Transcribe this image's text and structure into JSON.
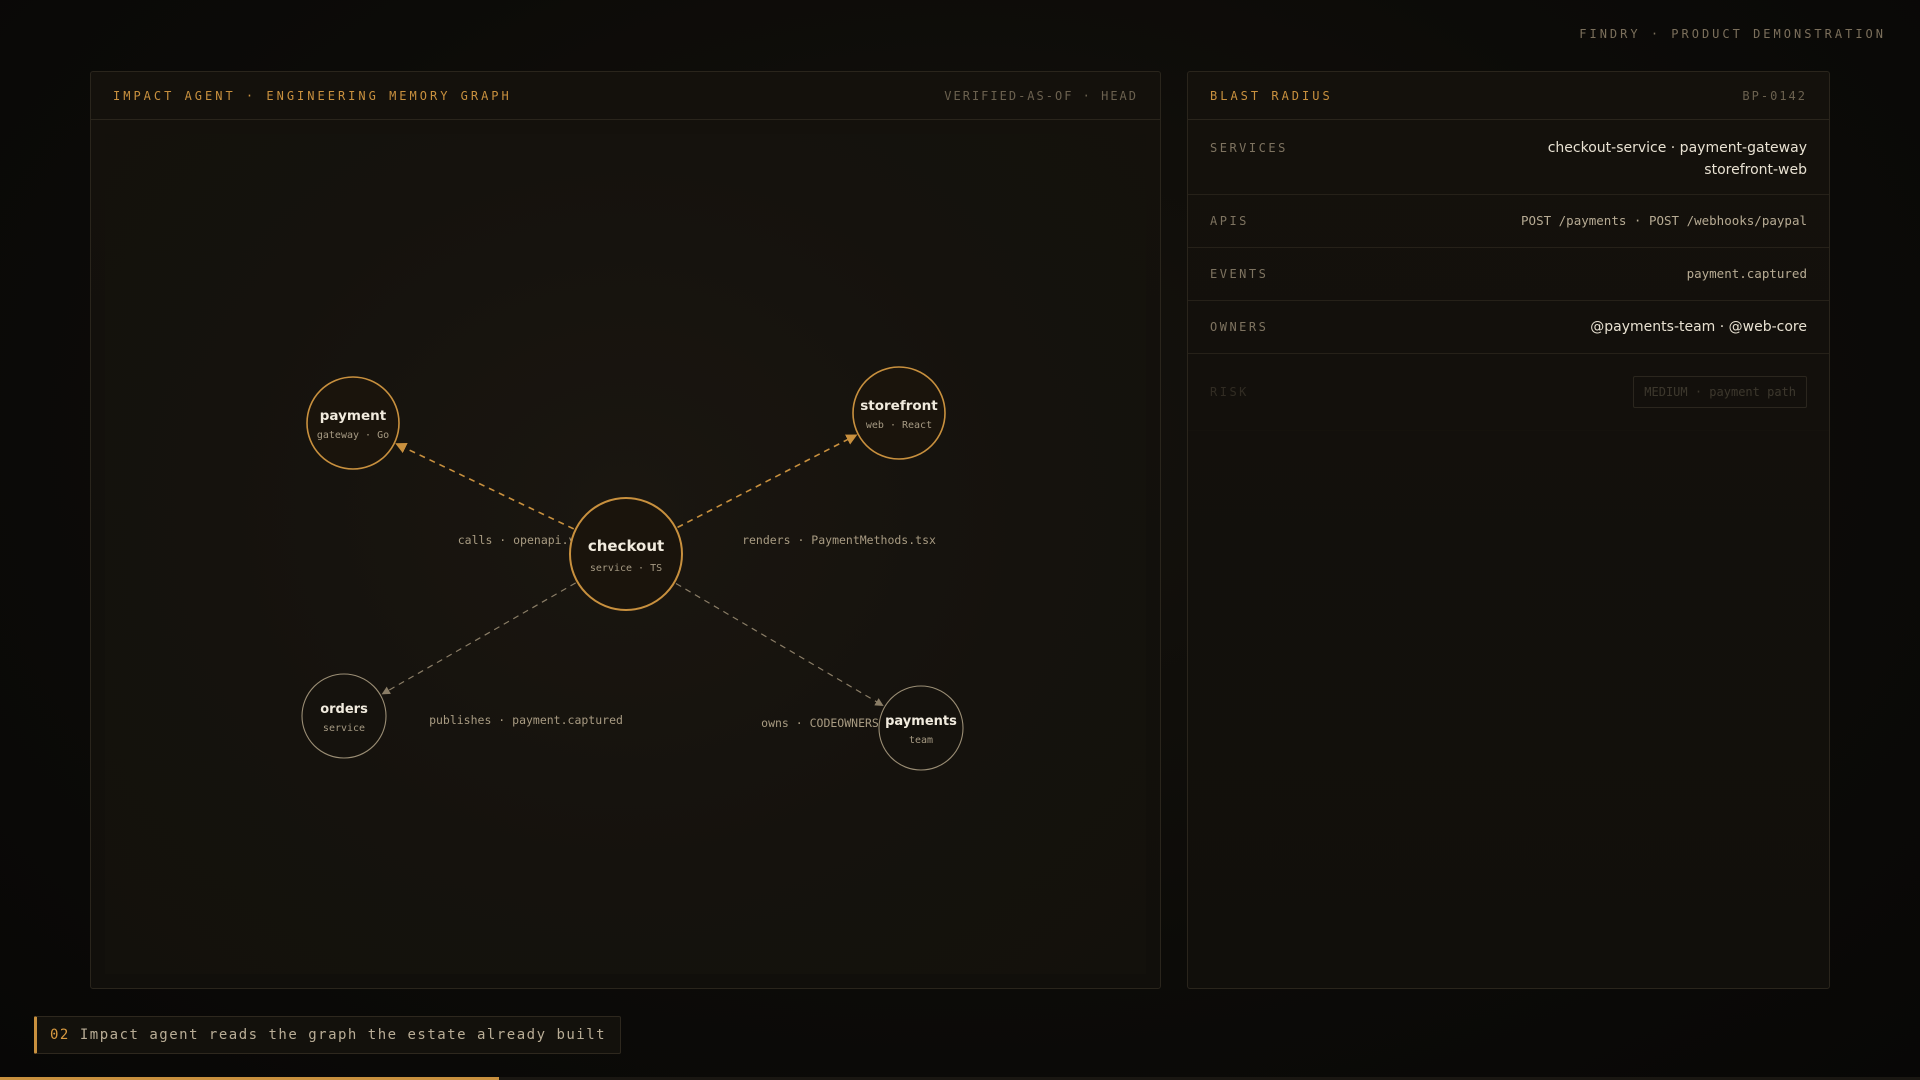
{
  "brand": "FINDRY · PRODUCT DEMONSTRATION",
  "graph_panel": {
    "title": "IMPACT AGENT · ENGINEERING MEMORY GRAPH",
    "status": "VERIFIED-AS-OF · HEAD"
  },
  "graph": {
    "nodes": [
      {
        "id": "checkout",
        "title": "checkout",
        "subtitle": "service · TS",
        "primary": true
      },
      {
        "id": "payment",
        "title": "payment",
        "subtitle": "gateway · Go",
        "primary": true
      },
      {
        "id": "storefront",
        "title": "storefront",
        "subtitle": "web · React",
        "primary": true
      },
      {
        "id": "orders",
        "title": "orders",
        "subtitle": "service",
        "primary": false
      },
      {
        "id": "payments",
        "title": "payments",
        "subtitle": "team",
        "primary": false
      }
    ],
    "edges": [
      {
        "from": "checkout",
        "to": "payment",
        "label": "calls · openapi.yaml",
        "style": "primary"
      },
      {
        "from": "checkout",
        "to": "storefront",
        "label": "renders · PaymentMethods.tsx",
        "style": "primary"
      },
      {
        "from": "checkout",
        "to": "orders",
        "label": "publishes · payment.captured",
        "style": "secondary"
      },
      {
        "from": "checkout",
        "to": "payments",
        "label": "owns · CODEOWNERS",
        "style": "secondary"
      }
    ]
  },
  "blast_radius": {
    "title": "BLAST RADIUS",
    "id": "BP-0142",
    "services_label": "SERVICES",
    "services_line1": "checkout-service · payment-gateway",
    "services_line2": "storefront-web",
    "apis_label": "APIS",
    "apis_value": "POST /payments · POST /webhooks/paypal",
    "events_label": "EVENTS",
    "events_value": "payment.captured",
    "owners_label": "OWNERS",
    "owners_value": "@payments-team · @web-core",
    "risk_label": "RISK",
    "risk_value": "MEDIUM · payment path"
  },
  "caption": {
    "number": "02",
    "text": "Impact agent reads the graph the estate already built"
  },
  "progress": {
    "fraction": 0.26
  },
  "colors": {
    "accent": "#c8903e",
    "secondary_stroke": "#8a7d66",
    "background": "#0c0b08"
  }
}
